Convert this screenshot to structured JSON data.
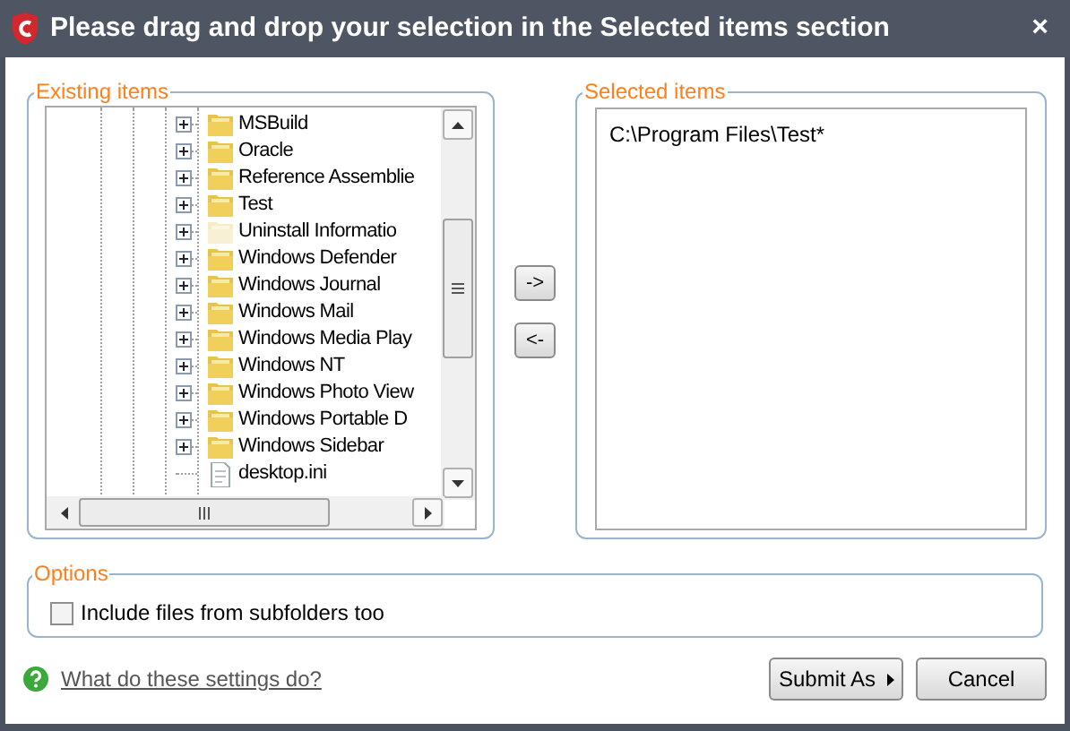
{
  "window": {
    "title": "Please drag and drop your selection in the Selected items section",
    "close": "×"
  },
  "existing_items": {
    "legend": "Existing items",
    "tree": [
      {
        "label": "MSBuild",
        "kind": "folder",
        "expandable": true,
        "hidden": false
      },
      {
        "label": "Oracle",
        "kind": "folder",
        "expandable": true,
        "hidden": false
      },
      {
        "label": "Reference Assemblie",
        "kind": "folder",
        "expandable": true,
        "hidden": false
      },
      {
        "label": "Test",
        "kind": "folder",
        "expandable": true,
        "hidden": false
      },
      {
        "label": "Uninstall Informatio",
        "kind": "folder",
        "expandable": true,
        "hidden": true
      },
      {
        "label": "Windows Defender",
        "kind": "folder",
        "expandable": true,
        "hidden": false
      },
      {
        "label": "Windows Journal",
        "kind": "folder",
        "expandable": true,
        "hidden": false
      },
      {
        "label": "Windows Mail",
        "kind": "folder",
        "expandable": true,
        "hidden": false
      },
      {
        "label": "Windows Media Play",
        "kind": "folder",
        "expandable": true,
        "hidden": false
      },
      {
        "label": "Windows NT",
        "kind": "folder",
        "expandable": true,
        "hidden": false
      },
      {
        "label": "Windows Photo View",
        "kind": "folder",
        "expandable": true,
        "hidden": false
      },
      {
        "label": "Windows Portable D",
        "kind": "folder",
        "expandable": true,
        "hidden": false
      },
      {
        "label": "Windows Sidebar",
        "kind": "folder",
        "expandable": true,
        "hidden": false
      },
      {
        "label": "desktop.ini",
        "kind": "file",
        "expandable": false,
        "hidden": false
      }
    ]
  },
  "move_buttons": [
    "->",
    "<-"
  ],
  "selected_items": {
    "legend": "Selected items",
    "items": [
      "C:\\Program Files\\Test*"
    ]
  },
  "options": {
    "legend": "Options",
    "checkbox": {
      "label": "Include files from subfolders too",
      "checked": false
    }
  },
  "help_link": "What do these settings do?",
  "buttons": {
    "submit": "Submit As",
    "cancel": "Cancel"
  }
}
